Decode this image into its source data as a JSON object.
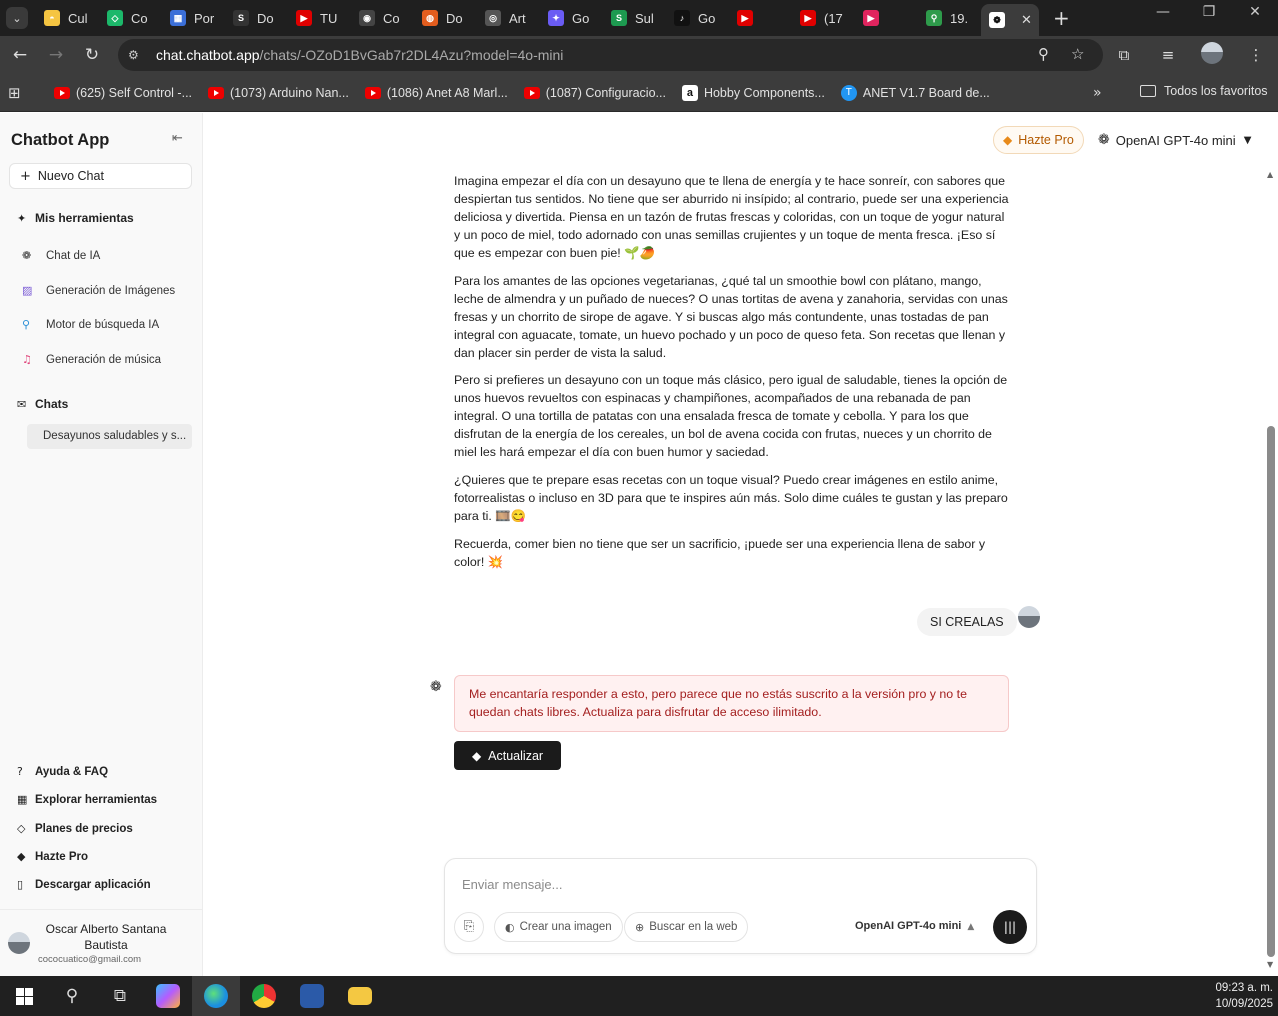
{
  "browser": {
    "tabs": [
      {
        "label": "Cul",
        "color": "#f5c542",
        "glyph": "◓"
      },
      {
        "label": "Co",
        "color": "#1cb86a",
        "glyph": "◇"
      },
      {
        "label": "Por",
        "color": "#3b6fd8",
        "glyph": "▦"
      },
      {
        "label": "Do",
        "color": "#333333",
        "glyph": "S"
      },
      {
        "label": "TU",
        "color": "#e00000",
        "glyph": "▶"
      },
      {
        "label": "Co",
        "color": "#444444",
        "glyph": "◉"
      },
      {
        "label": "Do",
        "color": "#e35d1e",
        "glyph": "◍"
      },
      {
        "label": "Art",
        "color": "#555555",
        "glyph": "◎"
      },
      {
        "label": "Go",
        "color": "#6a5cf4",
        "glyph": "✦"
      },
      {
        "label": "Sul",
        "color": "#1d9a50",
        "glyph": "S"
      },
      {
        "label": "Go",
        "color": "#111111",
        "glyph": "♪"
      },
      {
        "label": "",
        "color": "#e00000",
        "glyph": "▶"
      },
      {
        "label": "(17",
        "color": "#e00000",
        "glyph": "▶"
      },
      {
        "label": "",
        "color": "#e0245e",
        "glyph": "▶"
      },
      {
        "label": "19.",
        "color": "#2e9b4b",
        "glyph": "⚲"
      }
    ],
    "active_tab_close": "✕",
    "new_tab": "+",
    "window_controls": {
      "minimize": "—",
      "restore": "❐",
      "close": "✕"
    },
    "url_host": "chat.chatbot.app",
    "url_path": "/chats/-OZoD1BvGab7r2DL4Azu?model=4o-mini",
    "bookmarks": [
      {
        "label": "(625) Self Control -...",
        "icon": "youtube"
      },
      {
        "label": "(1073) Arduino Nan...",
        "icon": "youtube"
      },
      {
        "label": "(1086) Anet A8 Marl...",
        "icon": "youtube"
      },
      {
        "label": "(1087) Configuracio...",
        "icon": "youtube"
      },
      {
        "label": "Hobby Components...",
        "icon": "amazon"
      },
      {
        "label": "ANET V1.7 Board de...",
        "icon": "anet"
      }
    ],
    "bookmarks_more": "»",
    "all_bookmarks": "Todos los favoritos"
  },
  "sidebar": {
    "title": "Chatbot App",
    "new_chat": "Nuevo Chat",
    "tools_heading": "Mis herramientas",
    "tools": [
      {
        "label": "Chat de IA",
        "icon": "openai-icon",
        "glyph": "❁",
        "color": "#333333"
      },
      {
        "label": "Generación de Imágenes",
        "icon": "image-icon",
        "glyph": "▨",
        "color": "#7b5cd6"
      },
      {
        "label": "Motor de búsqueda IA",
        "icon": "search-icon",
        "glyph": "⚲",
        "color": "#2b8fd6"
      },
      {
        "label": "Generación de música",
        "icon": "music-icon",
        "glyph": "♫",
        "color": "#e0457b"
      }
    ],
    "chats_heading": "Chats",
    "chats": [
      "Desayunos saludables y s..."
    ],
    "footer": [
      {
        "label": "Ayuda & FAQ",
        "icon": "help-icon",
        "glyph": "?"
      },
      {
        "label": "Explorar herramientas",
        "icon": "grid-icon",
        "glyph": "▦"
      },
      {
        "label": "Planes de precios",
        "icon": "tag-icon",
        "glyph": "◇"
      },
      {
        "label": "Hazte Pro",
        "icon": "diamond-icon",
        "glyph": "◆"
      },
      {
        "label": "Descargar aplicación",
        "icon": "phone-icon",
        "glyph": "▯"
      }
    ],
    "user_name": "Oscar Alberto Santana Bautista",
    "user_email": "cococuatico@gmail.com"
  },
  "header": {
    "pro_button": "Hazte Pro",
    "model": "OpenAI GPT-4o mini"
  },
  "conversation": {
    "paragraphs": [
      "Imagina empezar el día con un desayuno que te llena de energía y te hace sonreír, con sabores que despiertan tus sentidos. No tiene que ser aburrido ni insípido; al contrario, puede ser una experiencia deliciosa y divertida. Piensa en un tazón de frutas frescas y coloridas, con un toque de yogur natural y un poco de miel, todo adornado con unas semillas crujientes y un toque de menta fresca. ¡Eso sí que es empezar con buen pie! 🌱🥭",
      "Para los amantes de las opciones vegetarianas, ¿qué tal un smoothie bowl con plátano, mango, leche de almendra y un puñado de nueces? O unas tortitas de avena y zanahoria, servidas con unas fresas y un chorrito de sirope de agave. Y si buscas algo más contundente, unas tostadas de pan integral con aguacate, tomate, un huevo pochado y un poco de queso feta. Son recetas que llenan y dan placer sin perder de vista la salud.",
      "Pero si prefieres un desayuno con un toque más clásico, pero igual de saludable, tienes la opción de unos huevos revueltos con espinacas y champiñones, acompañados de una rebanada de pan integral. O una tortilla de patatas con una ensalada fresca de tomate y cebolla. Y para los que disfrutan de la energía de los cereales, un bol de avena cocida con frutas, nueces y un chorrito de miel les hará empezar el día con buen humor y saciedad.",
      "¿Quieres que te prepare esas recetas con un toque visual? Puedo crear imágenes en estilo anime, fotorrealistas o incluso en 3D para que te inspires aún más. Solo dime cuáles te gustan y las preparo para ti. 🎞️😋",
      "Recuerda, comer bien no tiene que ser un sacrificio, ¡puede ser una experiencia llena de sabor y color! 💥"
    ],
    "user_message": "SI CREALAS",
    "error_message": "Me encantaría responder a esto, pero parece que no estás suscrito a la versión pro y no te quedan chats libres. Actualiza para disfrutar de acceso ilimitado.",
    "upgrade_button": "Actualizar"
  },
  "composer": {
    "placeholder": "Enviar mensaje...",
    "create_image": "Crear una imagen",
    "search_web": "Buscar en la web",
    "model": "OpenAI GPT-4o mini"
  },
  "taskbar": {
    "time": "09:23 a. m.",
    "date": "10/09/2025"
  },
  "colors": {
    "error_text": "#a42020",
    "error_bg": "#fff1f1",
    "pro_accent": "#b35a00"
  }
}
